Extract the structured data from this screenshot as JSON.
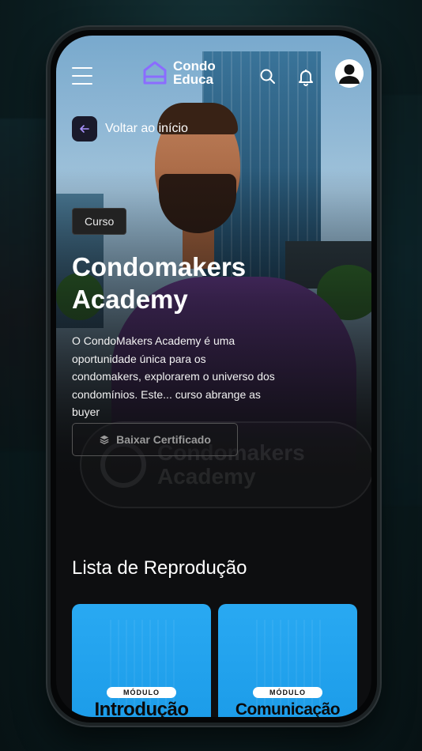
{
  "brand": {
    "line1": "Condo",
    "line2": "Educa",
    "accent": "#7c5cff"
  },
  "header": {
    "menu_icon": "hamburger-icon",
    "search_icon": "search-icon",
    "notifications_icon": "bell-icon",
    "profile_icon": "user-avatar-icon"
  },
  "back": {
    "label": "Voltar ao início",
    "icon": "arrow-left-icon"
  },
  "course": {
    "tag": "Curso",
    "title": "Condomakers Academy",
    "description": "O CondoMakers Academy é uma oportunidade única para os condomakers, explorarem o universo dos condomínios. Este... curso abrange as buyer",
    "certificate_button": "Baixar Certificado",
    "certificate_icon": "layers-icon",
    "watermark": "Condomakers Academy"
  },
  "playlist": {
    "title": "Lista de Reprodução",
    "modules": [
      {
        "tag": "MÓDULO",
        "title": "Introdução"
      },
      {
        "tag": "MÓDULO",
        "title": "Comunicação"
      }
    ]
  },
  "colors": {
    "card": "#1f9fec",
    "background": "#0d0e10"
  }
}
